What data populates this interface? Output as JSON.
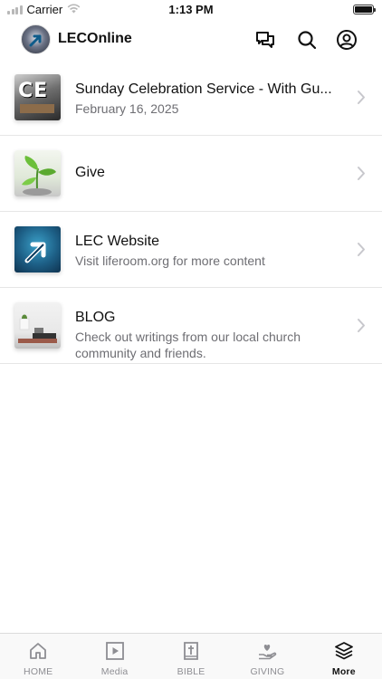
{
  "status_bar": {
    "carrier": "Carrier",
    "time": "1:13 PM"
  },
  "header": {
    "app_title": "LECOnline"
  },
  "list": [
    {
      "title": "Sunday Celebration Service - With Gu...",
      "subtitle": "February 16, 2025",
      "thumb_text": "CE"
    },
    {
      "title": "Give",
      "subtitle": ""
    },
    {
      "title": "LEC Website",
      "subtitle": "Visit liferoom.org for more content"
    },
    {
      "title": "BLOG",
      "subtitle": "Check out writings from our local church community and friends."
    }
  ],
  "tabbar": {
    "tabs": [
      {
        "label": "HOME",
        "icon": "home-icon",
        "active": false
      },
      {
        "label": "Media",
        "icon": "play-icon",
        "active": false
      },
      {
        "label": "BIBLE",
        "icon": "bible-icon",
        "active": false
      },
      {
        "label": "GIVING",
        "icon": "giving-icon",
        "active": false
      },
      {
        "label": "More",
        "icon": "layers-icon",
        "active": true
      }
    ]
  },
  "colors": {
    "text": "#111111",
    "secondary": "#6e6e73",
    "inactive_tab": "#8e8e93",
    "separator": "#e6e6e6"
  }
}
